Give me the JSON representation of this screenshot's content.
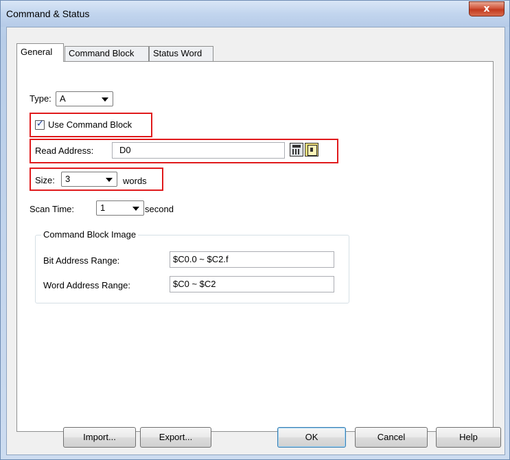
{
  "window": {
    "title": "Command & Status",
    "close_label": "x"
  },
  "tabs": [
    {
      "label": "General"
    },
    {
      "label": "Command Block"
    },
    {
      "label": "Status Word"
    }
  ],
  "general": {
    "type_label": "Type:",
    "type_value": "A",
    "use_command_block_label": "Use Command Block",
    "use_command_block_checked": true,
    "read_address_label": "Read Address:",
    "read_address_value": "D0",
    "size_label": "Size:",
    "size_value": "3",
    "size_unit": "words",
    "scan_time_label": "Scan Time:",
    "scan_time_value": "1",
    "scan_time_unit": "second"
  },
  "command_block_image": {
    "title": "Command Block Image",
    "bit_range_label": "Bit Address Range:",
    "bit_range_value": "$C0.0 ~ $C2.f",
    "word_range_label": "Word Address Range:",
    "word_range_value": "$C0 ~ $C2"
  },
  "buttons": {
    "import": "Import...",
    "export": "Export...",
    "ok": "OK",
    "cancel": "Cancel",
    "help": "Help"
  },
  "colors": {
    "highlight_box": "#e0191b",
    "title_bar": "#c2d5ee"
  }
}
